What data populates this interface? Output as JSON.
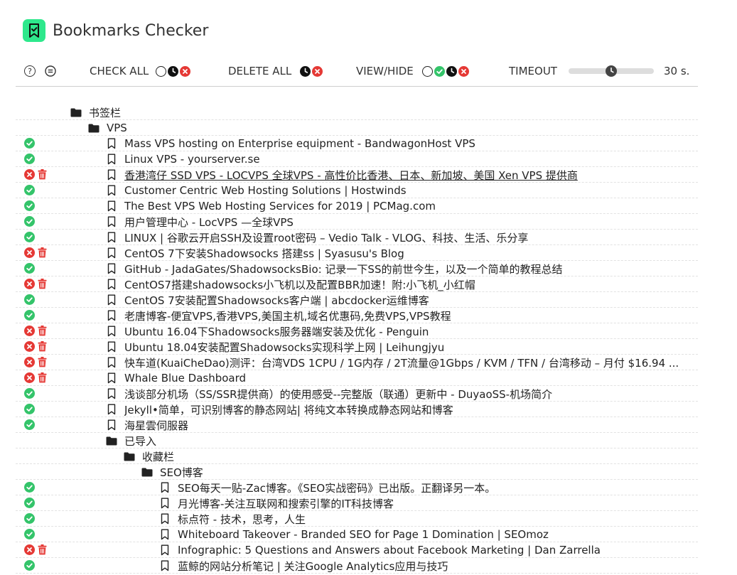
{
  "app": {
    "title": "Bookmarks Checker"
  },
  "toolbar": {
    "check_all": "CHECK ALL",
    "delete_all": "DELETE ALL",
    "view_hide": "VIEW/HIDE",
    "timeout_label": "TIMEOUT",
    "timeout_value": "30 s.",
    "timeout_level": 0.5
  },
  "colors": {
    "ok": "#34c46a",
    "error": "#e53935",
    "logo": "#2ee88c"
  },
  "tree": [
    {
      "type": "folder",
      "depth": 0,
      "label": "书签栏"
    },
    {
      "type": "folder",
      "depth": 1,
      "label": "VPS"
    },
    {
      "type": "bookmark",
      "depth": 2,
      "status": "ok",
      "label": "Mass VPS hosting on Enterprise equipment - BandwagonHost VPS"
    },
    {
      "type": "bookmark",
      "depth": 2,
      "status": "ok",
      "label": "Linux VPS - yourserver.se"
    },
    {
      "type": "bookmark",
      "depth": 2,
      "status": "error",
      "underline": true,
      "label": "香港湾仔 SSD VPS - LOCVPS 全球VPS - 高性价比香港、日本、新加坡、美国 Xen VPS 提供商"
    },
    {
      "type": "bookmark",
      "depth": 2,
      "status": "ok",
      "label": "Customer Centric Web Hosting Solutions | Hostwinds"
    },
    {
      "type": "bookmark",
      "depth": 2,
      "status": "ok",
      "label": "The Best VPS Web Hosting Services for 2019 | PCMag.com"
    },
    {
      "type": "bookmark",
      "depth": 2,
      "status": "ok",
      "label": "用户管理中心 - LocVPS —全球VPS"
    },
    {
      "type": "bookmark",
      "depth": 2,
      "status": "ok",
      "label": "LINUX | 谷歌云开启SSH及设置root密码 – Vedio Talk - VLOG、科技、生活、乐分享"
    },
    {
      "type": "bookmark",
      "depth": 2,
      "status": "error",
      "label": "CentOS 7下安装Shadowsocks 搭建ss | Syasusu's Blog"
    },
    {
      "type": "bookmark",
      "depth": 2,
      "status": "ok",
      "label": "GitHub - JadaGates/ShadowsocksBio: 记录一下SS的前世今生，以及一个简单的教程总结"
    },
    {
      "type": "bookmark",
      "depth": 2,
      "status": "error",
      "label": "CentOS7搭建shadowsocks小飞机以及配置BBR加速！附:小飞机_小红帽"
    },
    {
      "type": "bookmark",
      "depth": 2,
      "status": "ok",
      "label": "CentOS 7安装配置Shadowsocks客户端 | abcdocker运维博客"
    },
    {
      "type": "bookmark",
      "depth": 2,
      "status": "ok",
      "label": "老唐博客-便宜VPS,香港VPS,美国主机,域名优惠码,免费VPS,VPS教程"
    },
    {
      "type": "bookmark",
      "depth": 2,
      "status": "error",
      "label": "Ubuntu 16.04下Shadowsocks服务器端安装及优化 - Penguin"
    },
    {
      "type": "bookmark",
      "depth": 2,
      "status": "error",
      "label": "Ubuntu 18.04安装配置Shadowsocks实现科学上网 | Leihungjyu"
    },
    {
      "type": "bookmark",
      "depth": 2,
      "status": "error",
      "label": "快车道(KuaiCheDao)测评：台湾VDS 1CPU / 1G内存 / 2T流量@1Gbps / KVM / TFN / 台湾移动 – 月付 $16.94 ..."
    },
    {
      "type": "bookmark",
      "depth": 2,
      "status": "error",
      "label": "Whale Blue Dashboard"
    },
    {
      "type": "bookmark",
      "depth": 2,
      "status": "ok",
      "label": "浅谈部分机场（SS/SSR提供商）的使用感受--完整版（联通）更新中 - DuyaoSS-机场简介"
    },
    {
      "type": "bookmark",
      "depth": 2,
      "status": "ok",
      "label": "Jekyll•简单，可识别博客的静态网站| 将纯文本转换成静态网站和博客"
    },
    {
      "type": "bookmark",
      "depth": 2,
      "status": "ok",
      "label": "海星雲伺服器"
    },
    {
      "type": "folder",
      "depth": 2,
      "label": "已导入"
    },
    {
      "type": "folder",
      "depth": 3,
      "label": "收藏栏"
    },
    {
      "type": "folder",
      "depth": 4,
      "label": "SEO博客"
    },
    {
      "type": "bookmark",
      "depth": 5,
      "status": "ok",
      "label": "SEO每天一贴-Zac博客。《SEO实战密码》已出版。正翻译另一本。"
    },
    {
      "type": "bookmark",
      "depth": 5,
      "status": "ok",
      "label": "月光博客-关注互联网和搜索引擎的IT科技博客"
    },
    {
      "type": "bookmark",
      "depth": 5,
      "status": "ok",
      "label": "标点符 - 技术，思考，人生"
    },
    {
      "type": "bookmark",
      "depth": 5,
      "status": "ok",
      "label": "Whiteboard Takeover - Branded SEO for Page 1 Domination | SEOmoz"
    },
    {
      "type": "bookmark",
      "depth": 5,
      "status": "error",
      "label": "Infographic: 5 Questions and Answers about Facebook Marketing | Dan Zarrella"
    },
    {
      "type": "bookmark",
      "depth": 5,
      "status": "ok",
      "label": "蓝鲸的网站分析笔记 | 关注Google Analytics应用与技巧"
    }
  ]
}
